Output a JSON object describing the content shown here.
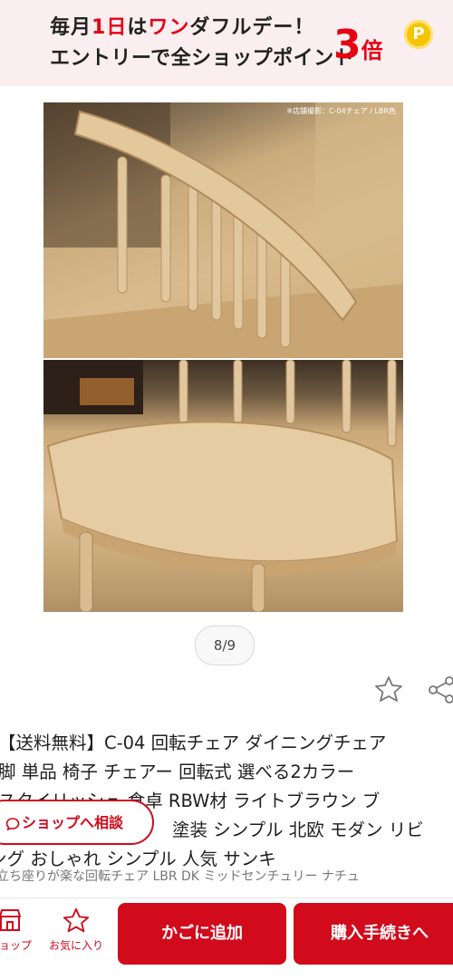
{
  "banner": {
    "line1_pre": "毎月",
    "line1_day": "1日",
    "line1_mid": "は",
    "line1_brand": "ワン",
    "line1_post": "ダフルデー！",
    "line2": "エントリーで全ショップポイント",
    "multiplier_num": "3",
    "multiplier_unit": "倍",
    "coin_label": "P"
  },
  "gallery": {
    "photo_caption": "※店舗撮影：C-04チェア / LBR色",
    "counter": "8/9"
  },
  "product": {
    "title_lines": [
      "【送料無料】C-04 回転チェア ダイニングチェア",
      "脚 単品 椅子 チェアー 回転式 選べる2カラー",
      "スタイリッシュ 食卓 RBW材 ライトブラウン ブ",
      "塗装 シンプル 北欧 モダン リビ",
      "ング おしゃれ シンプル 人気 サンキ"
    ],
    "subtitle": "立ち座りが楽な回転チェア LBR DK ミッドセンチュリー ナチュ"
  },
  "consult_button": {
    "label": "ショップへ相談"
  },
  "bottom_nav": {
    "shop_label": "ショップ",
    "fav_label": "お気に入り",
    "cart_label": "かごに追加",
    "buy_label": "購入手続きへ"
  },
  "colors": {
    "accent": "#d10a1c",
    "banner_bg": "#fbeef0",
    "coin": "#f5c400"
  },
  "icons": [
    "store-icon",
    "star-icon",
    "share-icon",
    "chat-icon",
    "coin-icon"
  ]
}
